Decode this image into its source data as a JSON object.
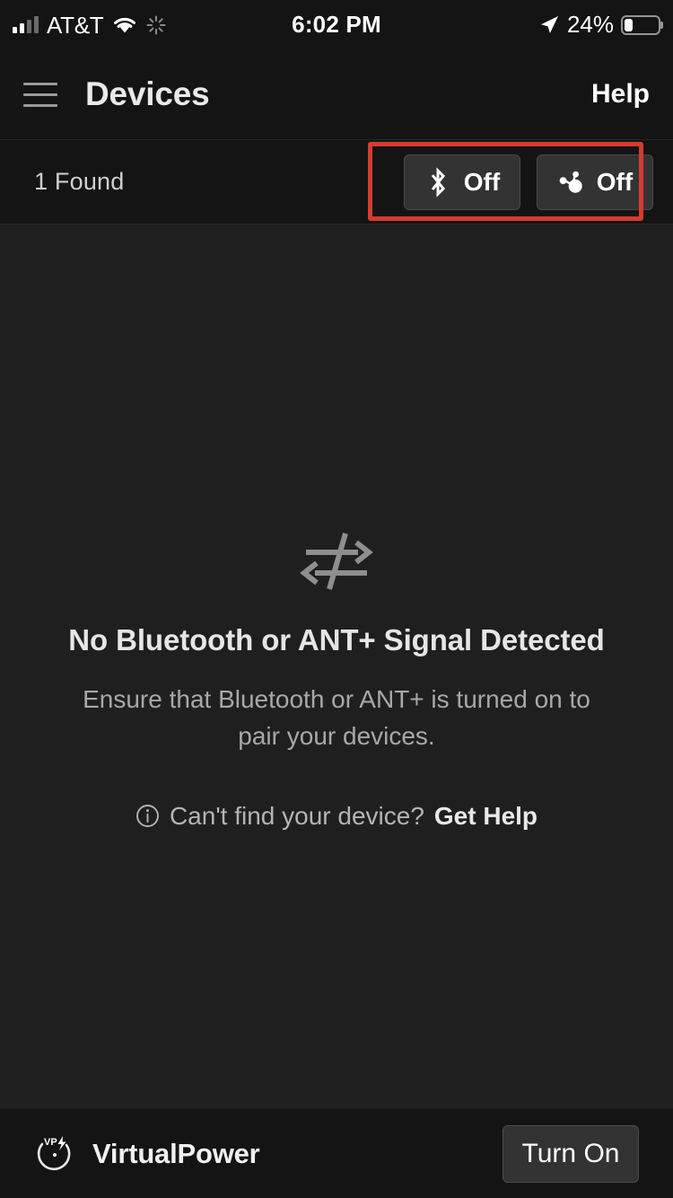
{
  "status_bar": {
    "carrier": "AT&T",
    "time": "6:02 PM",
    "battery_percent": "24%",
    "signal_icon": "cellular-signal-icon",
    "wifi_icon": "wifi-icon",
    "activity_icon": "activity-spinner-icon",
    "location_icon": "location-arrow-icon",
    "battery_icon": "battery-icon"
  },
  "header": {
    "menu_icon": "hamburger-menu-icon",
    "title": "Devices",
    "help_label": "Help"
  },
  "subbar": {
    "found_label": "1 Found",
    "toggles": [
      {
        "icon": "bluetooth-icon",
        "label": "Off"
      },
      {
        "icon": "ant-plus-icon",
        "label": "Off"
      }
    ],
    "highlight_color": "#d63b2f"
  },
  "empty_state": {
    "icon": "no-signal-transfer-icon",
    "title": "No Bluetooth or ANT+ Signal Detected",
    "body": "Ensure that Bluetooth or ANT+ is turned on to pair your devices.",
    "help_info_icon": "info-circle-icon",
    "help_question": "Can't find your device?",
    "help_link": "Get Help"
  },
  "bottom_bar": {
    "brand_logo_icon": "virtualpower-gauge-logo",
    "brand_name": "VirtualPower",
    "action_label": "Turn On"
  },
  "colors": {
    "background": "#1f1f1f",
    "chrome": "#141414",
    "button": "#333333",
    "accent_red": "#d63b2f",
    "text_primary": "#ffffff",
    "text_secondary": "#a8a8a8"
  }
}
